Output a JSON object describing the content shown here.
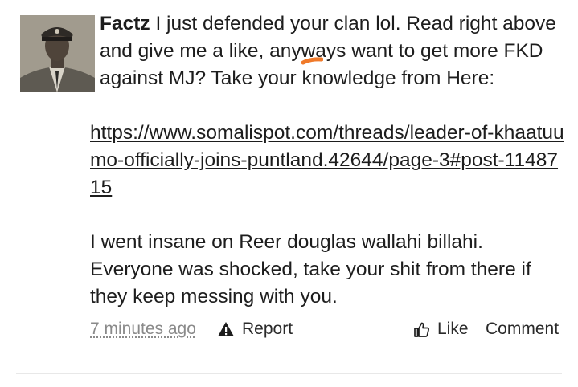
{
  "post": {
    "username": "Factz",
    "intro_text": " I just defended your clan lol. Read right above and give me a like, anyways want to get more FKD against MJ? Take your knowledge from Here:",
    "link_text": "https://www.somalispot.com/threads/leader-of-khaatuumo-officially-joins-puntland.42644/page-3#post-1148715",
    "body_text": "I went insane on Reer douglas wallahi billahi. Everyone was shocked, take your shit from there if they keep messing with you."
  },
  "footer": {
    "time": "7 minutes ago",
    "report_label": "Report",
    "like_label": "Like",
    "comment_label": "Comment"
  },
  "icons": {
    "report": "warning-triangle-icon",
    "like": "thumbs-up-icon"
  },
  "colors": {
    "text": "#1d1d1d",
    "muted": "#8a8a8a",
    "highlight_mark": "#f07a2a"
  }
}
